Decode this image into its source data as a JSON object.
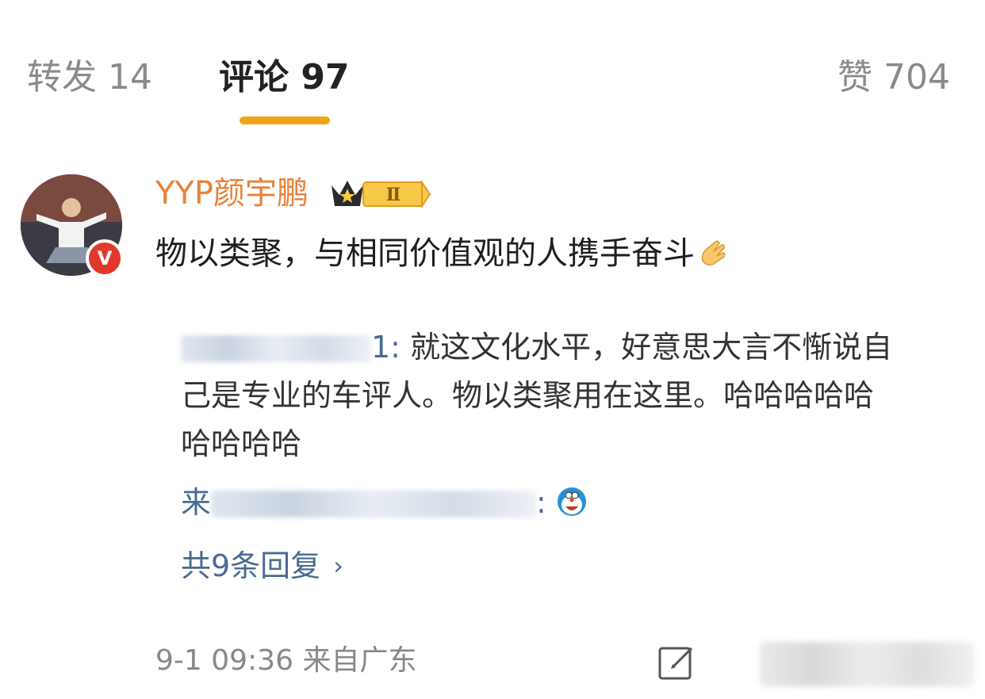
{
  "tabs": {
    "repost": "转发 14",
    "comments": "评论 97",
    "likes": "赞 704",
    "accent": "#f2a51a"
  },
  "comment": {
    "username": "YYP颜宇鹏",
    "text": "物以类聚，与相同价值观的人携手奋斗",
    "verified_badge": "V",
    "badge_level": "Ⅱ",
    "time": "9-1 09:36",
    "location": "来自广东"
  },
  "replies": {
    "first_author_suffix": "1:",
    "first_text": " 就这文化水平，好意思大言不惭说自己是专业的车评人。物以类聚用在这里。哈哈哈哈哈哈哈哈哈",
    "second_prefix": "来",
    "second_suffix": ":",
    "view_more": "共9条回复",
    "chevron": "›"
  },
  "icons": [
    "crown-icon",
    "clap-icon",
    "doraemon-icon",
    "chevron-right-icon",
    "edit-icon"
  ],
  "colors": {
    "username": "#e8813a",
    "link": "#4a6a94",
    "badge": "#e0392b"
  }
}
